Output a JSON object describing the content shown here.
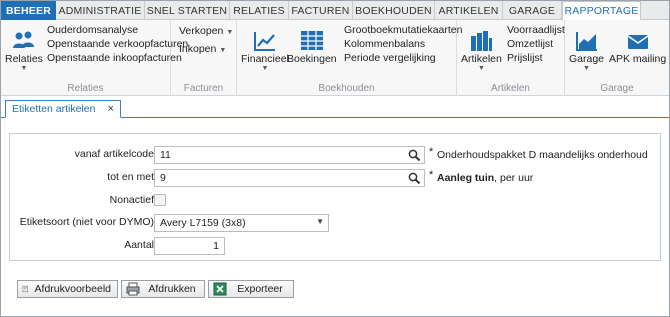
{
  "tabs": [
    "BEHEER",
    "ADMINISTRATIE",
    "SNEL STARTEN",
    "RELATIES",
    "FACTUREN",
    "BOEKHOUDEN",
    "ARTIKELEN",
    "GARAGE",
    "RAPPORTAGE"
  ],
  "ribbon": {
    "relaties": {
      "big_label": "Relaties",
      "items": [
        "Ouderdomsanalyse",
        "Openstaande verkoopfacturen",
        "Openstaande inkoopfacturen"
      ],
      "group_label": "Relaties"
    },
    "facturen": {
      "items": [
        "Verkopen",
        "Inkopen"
      ],
      "group_label": "Facturen"
    },
    "boekhouden": {
      "financieel_label": "Financieel",
      "boekingen_label": "Boekingen",
      "items": [
        "Grootboekmutatiekaarten",
        "Kolommenbalans",
        "Periode vergelijking"
      ],
      "group_label": "Boekhouden"
    },
    "artikelen": {
      "big_label": "Artikelen",
      "items": [
        "Voorraadlijst",
        "Omzetlijst",
        "Prijslijst"
      ],
      "group_label": "Artikelen"
    },
    "garage": {
      "garage_label": "Garage",
      "apk_label": "APK mailing",
      "group_label": "Garage"
    }
  },
  "doc_tab": {
    "label": "Etiketten artikelen",
    "close": "×"
  },
  "form": {
    "vanaf_label": "vanaf artikelcode",
    "vanaf_value": "11",
    "vanaf_desc": "Onderhoudspakket D maandelijks onderhoud",
    "totmet_label": "tot en met",
    "totmet_value": "9",
    "totmet_desc_bold": "Aanleg tuin",
    "totmet_desc_rest": ", per uur",
    "asterisk": "*",
    "nonactief_label": "Nonactief",
    "etiketsoort_label": "Etiketsoort (niet voor DYMO)",
    "etiketsoort_value": "Avery L7159 (3x8)",
    "aantal_label": "Aantal",
    "aantal_value": "1"
  },
  "buttons": {
    "afdrukvoorbeeld": "Afdrukvoorbeeld",
    "afdrukken": "Afdrukken",
    "exporteer": "Exporteer"
  },
  "colors": {
    "accent": "#1f6fb5",
    "tab_active_text": "#1f6fb5"
  }
}
